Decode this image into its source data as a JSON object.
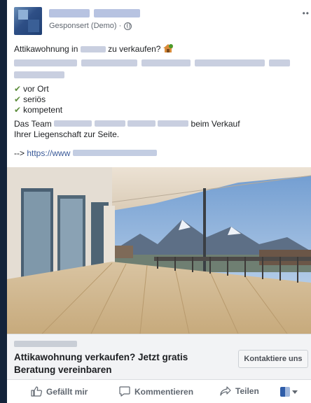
{
  "post": {
    "sponsored_label": "Gesponsert (Demo) ·",
    "headline_before": "Attikawohnung in",
    "headline_after": "zu verkaufen?",
    "checks": [
      "vor Ort",
      "seriös",
      "kompetent"
    ],
    "team_before": "Das Team",
    "team_after": "beim Verkauf",
    "team_line2": "Ihrer Liegenschaft zur Seite.",
    "link_prefix": "-->",
    "link_text": "https://www"
  },
  "cta": {
    "title": "Attikawohnung verkaufen? Jetzt gratis Beratung vereinbaren",
    "button_label": "Kontaktiere uns"
  },
  "actions": {
    "like_label": "Gefällt mir",
    "comment_label": "Kommentieren",
    "share_label": "Teilen"
  },
  "icons": {
    "more": "more-icon",
    "globe": "globe-icon",
    "house": "house-emoji",
    "check": "check-icon",
    "like": "thumbs-up-icon",
    "comment": "comment-bubble-icon",
    "share": "share-arrow-icon"
  },
  "colors": {
    "background": "#13233a",
    "card": "#ffffff",
    "link": "#385898",
    "check": "#5f8e3e"
  }
}
